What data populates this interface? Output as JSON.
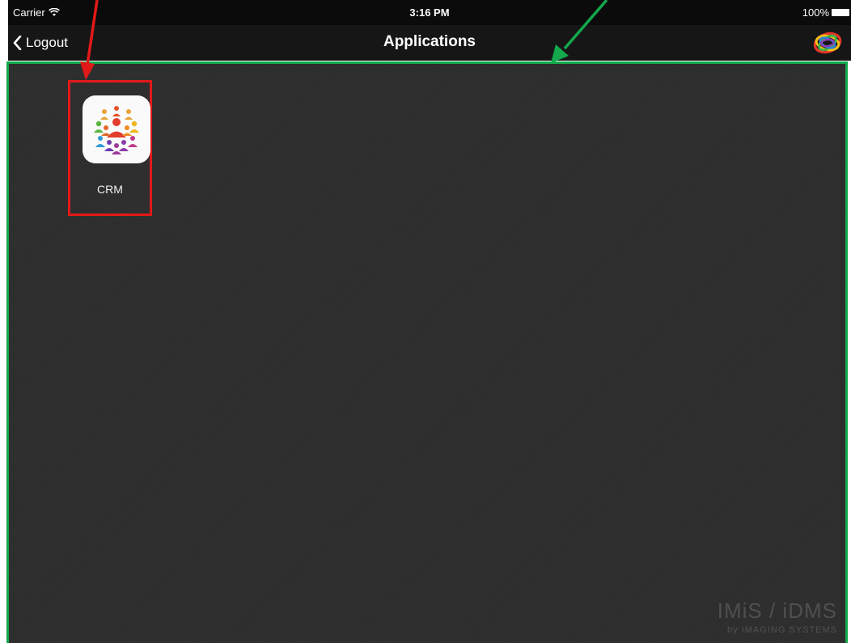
{
  "status_bar": {
    "carrier": "Carrier",
    "time": "3:16 PM",
    "battery": "100%"
  },
  "nav_bar": {
    "back_label": "Logout",
    "title": "Applications",
    "logo_icon": "swirl-logo-icon"
  },
  "apps": [
    {
      "label": "CRM",
      "icon": "crm-people-icon"
    }
  ],
  "watermark": {
    "main": "IMiS / iDMS",
    "by": "by",
    "sub": "IMAGING SYSTEMS"
  },
  "colors": {
    "status_bar_bg": "#0b0b0b",
    "nav_bar_bg": "#161616",
    "content_bg": "#2c2c2c",
    "highlight_red": "#e21919",
    "highlight_green": "#13a94c"
  }
}
